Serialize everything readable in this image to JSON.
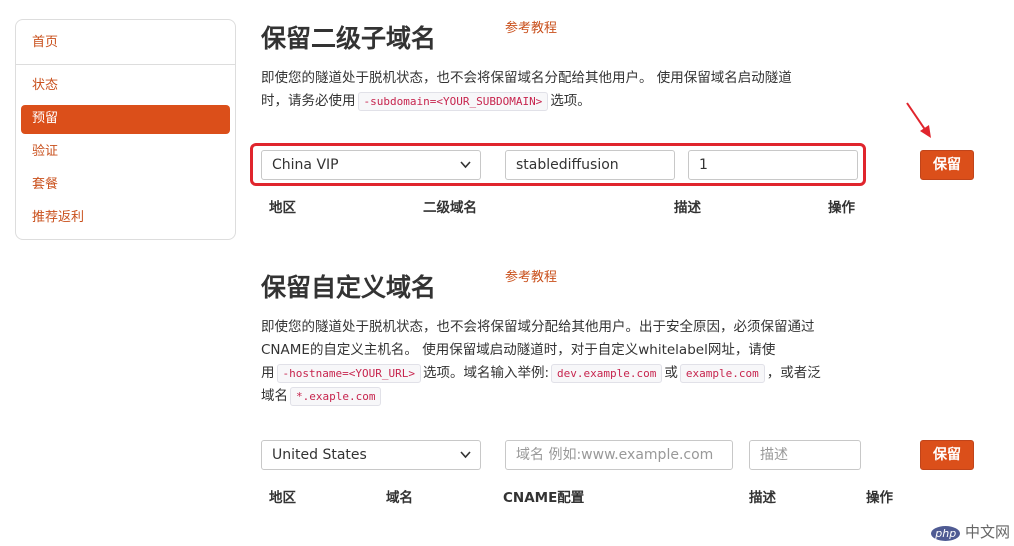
{
  "sidebar": {
    "home": "首页",
    "items": [
      "状态",
      "预留",
      "验证",
      "套餐",
      "推荐返利"
    ],
    "active_index": 1
  },
  "subdomain_section": {
    "title": "保留二级子域名",
    "reference_link": "参考教程",
    "desc_line1": "即使您的隧道处于脱机状态，也不会将保留域名分配给其他用户。 使用保留域名启动隧道",
    "desc_line2_a": "时，请务必使用",
    "desc_code": "-subdomain=<YOUR_SUBDOMAIN>",
    "desc_line2_b": "选项。",
    "region_value": "China VIP",
    "subdomain_value": "stablediffusion",
    "description_value": "1",
    "save_label": "保留",
    "columns": [
      "地区",
      "二级域名",
      "描述",
      "操作"
    ]
  },
  "custom_section": {
    "title": "保留自定义域名",
    "reference_link": "参考教程",
    "desc_line1": "即使您的隧道处于脱机状态，也不会将保留域分配给其他用户。出于安全原因，必须保留通过",
    "desc_line2": "CNAME的自定义主机名。 使用保留域启动隧道时，对于自定义whitelabel网址，请使",
    "desc_line3_a": "用",
    "desc_code1": "-hostname=<YOUR_URL>",
    "desc_line3_b": "选项。域名输入举例:",
    "desc_code2": "dev.example.com",
    "desc_line3_c": "或",
    "desc_code3": "example.com",
    "desc_line3_d": "，或者泛",
    "desc_line4_a": "域名",
    "desc_code4": "*.exaple.com",
    "region_value": "United States",
    "domain_placeholder": "域名 例如:www.example.com",
    "description_placeholder": "描述",
    "save_label": "保留",
    "columns": [
      "地区",
      "域名",
      "CNAME配置",
      "描述",
      "操作"
    ]
  },
  "watermark": {
    "badge": "php",
    "text": "中文网"
  }
}
